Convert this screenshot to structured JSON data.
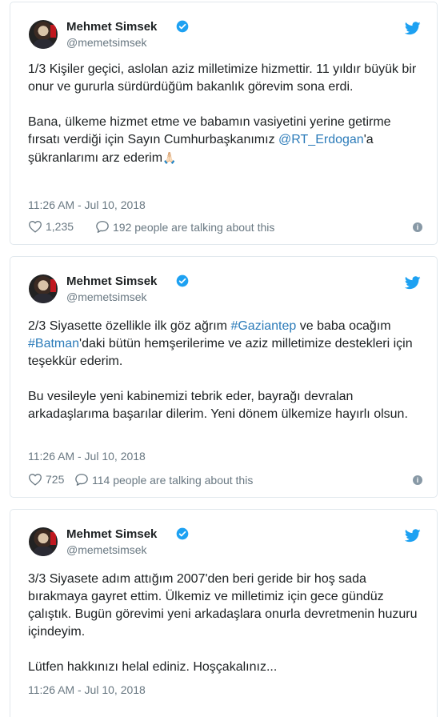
{
  "tweets": [
    {
      "author": "Mehmet Simsek",
      "handle": "@memetsimsek",
      "text_line1": "1/3 Kişiler geçici, aslolan aziz milletimize hizmettir. 11 yıldır büyük bir onur ve gururla sürdürdüğüm bakanlık görevim sona erdi.",
      "text_p2_pre": "Bana, ülkeme hizmet etme ve babamın vasiyetini yerine getirme fırsatı verdiği için Sayın Cumhurbaşkanımız ",
      "mention": "@RT_Erdogan",
      "text_p2_post": "'a şükranlarımı arz ederim",
      "emoji": "🙏🏻",
      "timestamp": "11:26 AM - Jul 10, 2018",
      "likes": "1,235",
      "talking": "192 people are talking about this"
    },
    {
      "author": "Mehmet Simsek",
      "handle": "@memetsimsek",
      "p1_pre": "2/3 Siyasette özellikle ilk göz ağrım ",
      "hashtag1": "#Gaziantep",
      "p1_mid": " ve baba ocağım ",
      "hashtag2": "#Batman",
      "p1_post": "'daki bütün hemşerilerime ve aziz milletimize destekleri için teşekkür ederim.",
      "p2": "Bu vesileyle yeni kabinemizi tebrik eder, bayrağı devralan arkadaşlarıma başarılar dilerim. Yeni dönem ülkemize hayırlı olsun.",
      "timestamp": "11:26 AM - Jul 10, 2018",
      "likes": "725",
      "talking": "114 people are talking about this"
    },
    {
      "author": "Mehmet Simsek",
      "handle": "@memetsimsek",
      "p1": "3/3 Siyasete adım attığım 2007'den beri geride bir hoş sada bırakmaya gayret ettim. Ülkemiz ve milletimiz için gece gündüz çalıştık. Bugün görevimi yeni arkadaşlara onurla devretmenin huzuru içindeyim.",
      "p2": "Lütfen hakkınızı helal ediniz. Hoşçakalınız...",
      "timestamp": "11:26 AM - Jul 10, 2018"
    }
  ],
  "colors": {
    "link": "#2b7bb9",
    "verified": "#1da1f2",
    "bird": "#1da1f2",
    "muted": "#697882"
  },
  "icons": [
    "avatar",
    "verified-badge-icon",
    "twitter-bird-icon",
    "heart-icon",
    "speech-bubble-icon",
    "info-icon"
  ]
}
